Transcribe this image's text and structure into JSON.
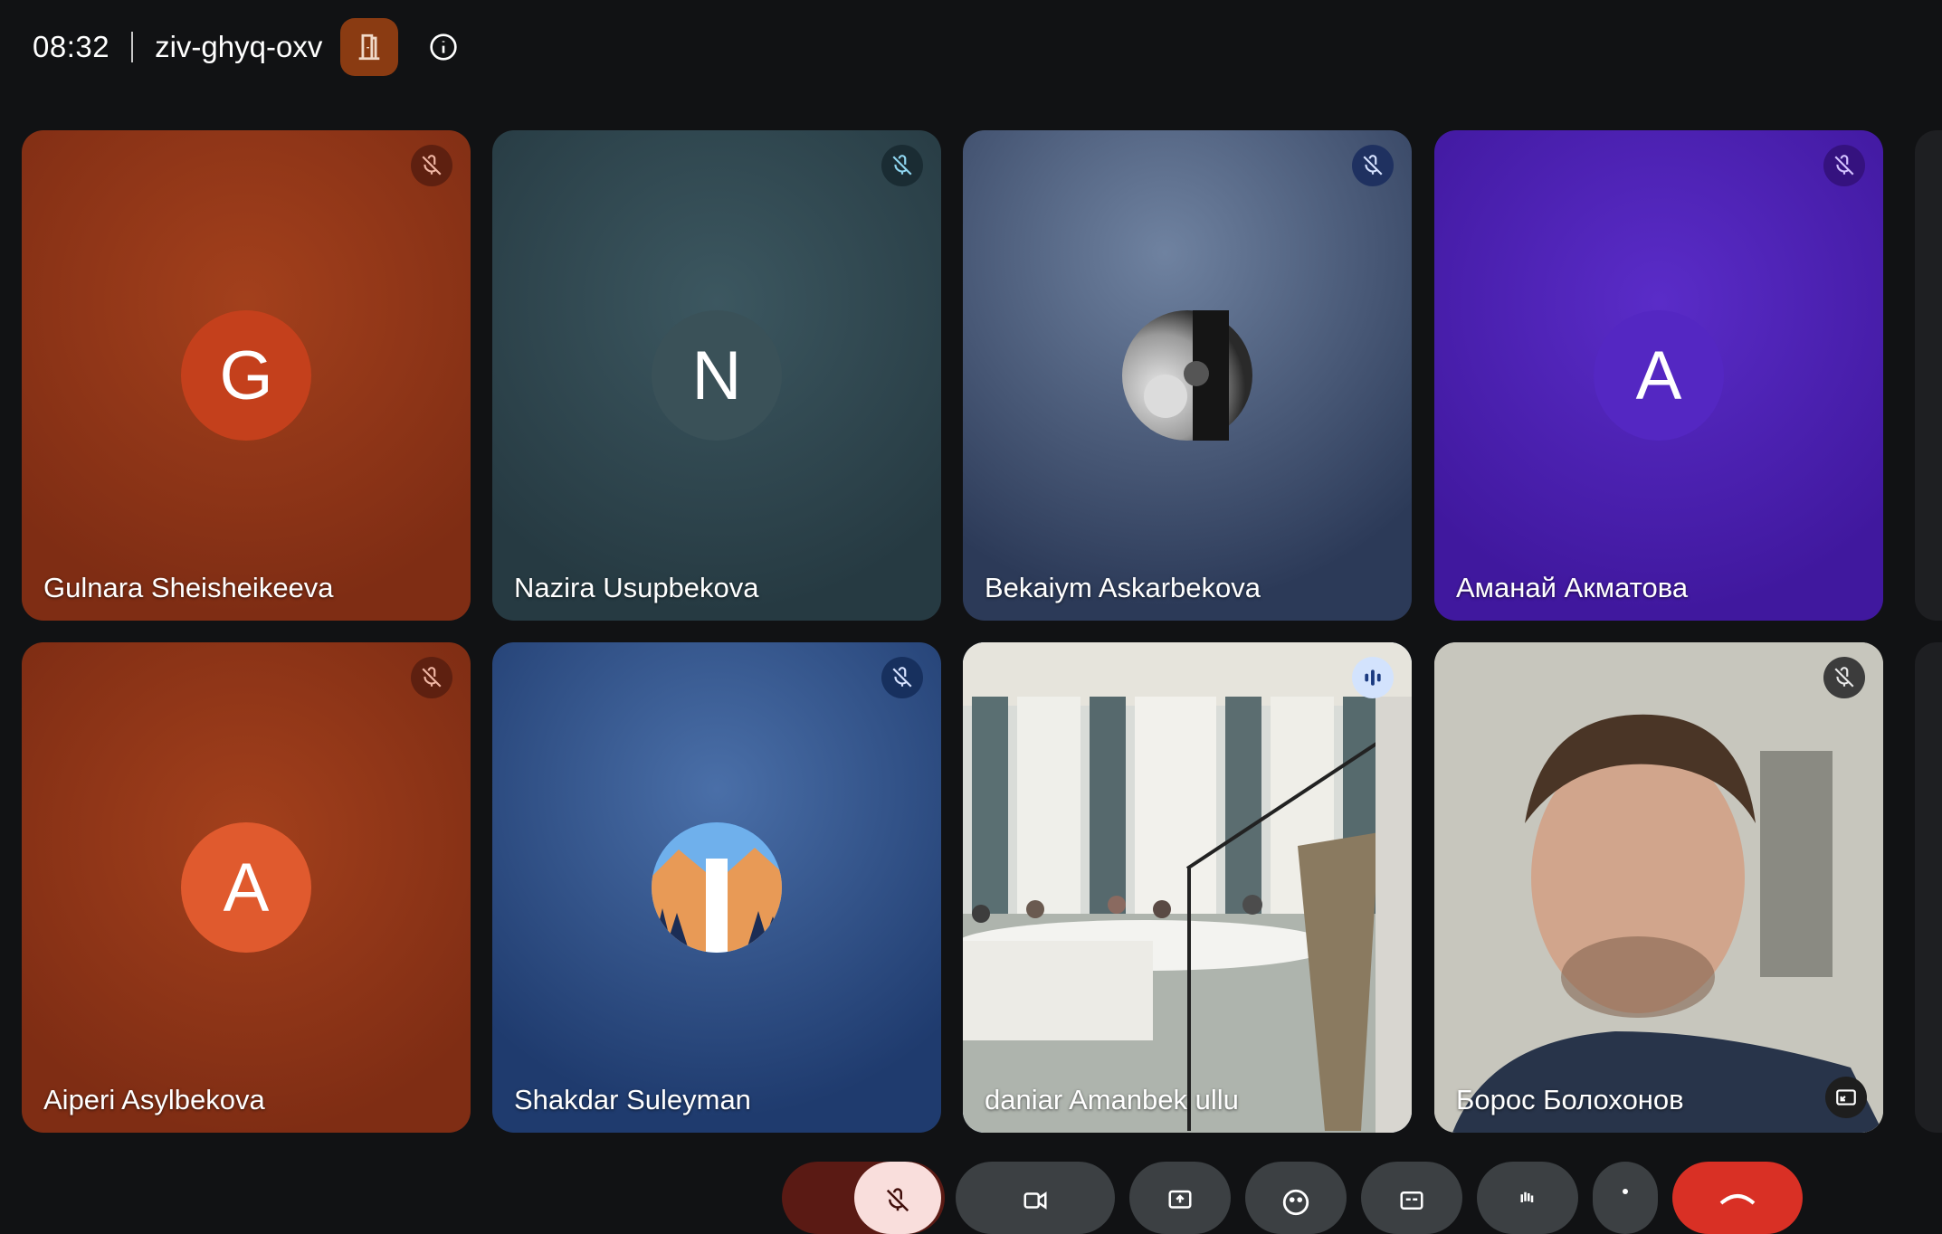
{
  "header": {
    "time": "08:32",
    "meeting_code": "ziv-ghyq-oxv",
    "icons": {
      "room": "door-icon",
      "info": "info-icon"
    }
  },
  "colors": {
    "background": "#111214",
    "room_button": "#8a3b12",
    "speaking_outline": "#a8c7fa",
    "end_call": "#d93025"
  },
  "participants": [
    {
      "name": "Gulnara Sheisheikeeva",
      "initial": "G",
      "tile_color": "#8d3417",
      "avatar_color": "#c4401c",
      "muted": true
    },
    {
      "name": "Nazira Usupbekova",
      "initial": "N",
      "tile_color": "#2c434b",
      "avatar_color": "#3a5158",
      "muted": true
    },
    {
      "name": "Bekaiym Askarbekova",
      "initial": "",
      "tile_color": "#34466b",
      "avatar_color": "#d0d0d0",
      "muted": true,
      "avatar_type": "photo"
    },
    {
      "name": "Аманай Акматова",
      "initial": "A",
      "tile_color": "#4a1eb0",
      "avatar_color": "#5427c2",
      "muted": true
    },
    {
      "name": "Aiperi Asylbekova",
      "initial": "A",
      "tile_color": "#8d3417",
      "avatar_color": "#e05a2e",
      "muted": true
    },
    {
      "name": "Shakdar Suleyman",
      "initial": "",
      "tile_color": "#2b4f86",
      "avatar_color": "#3f7fd8",
      "muted": true,
      "avatar_type": "landscape"
    },
    {
      "name": "daniar Amanbek ullu",
      "initial": "",
      "tile_color": "#c9cfd2",
      "muted": false,
      "speaking": true,
      "video": "conference-hall"
    },
    {
      "name": "Борос Болохонов",
      "initial": "",
      "tile_color": "#b9b7ad",
      "muted": true,
      "video": "webcam-portrait"
    }
  ],
  "controls": [
    {
      "name": "raise-hand-button"
    },
    {
      "name": "mic-button"
    },
    {
      "name": "camera-button"
    },
    {
      "name": "present-button"
    },
    {
      "name": "emoji-button"
    },
    {
      "name": "captions-button"
    },
    {
      "name": "hand-button"
    },
    {
      "name": "more-options-button"
    },
    {
      "name": "end-call-button"
    }
  ]
}
